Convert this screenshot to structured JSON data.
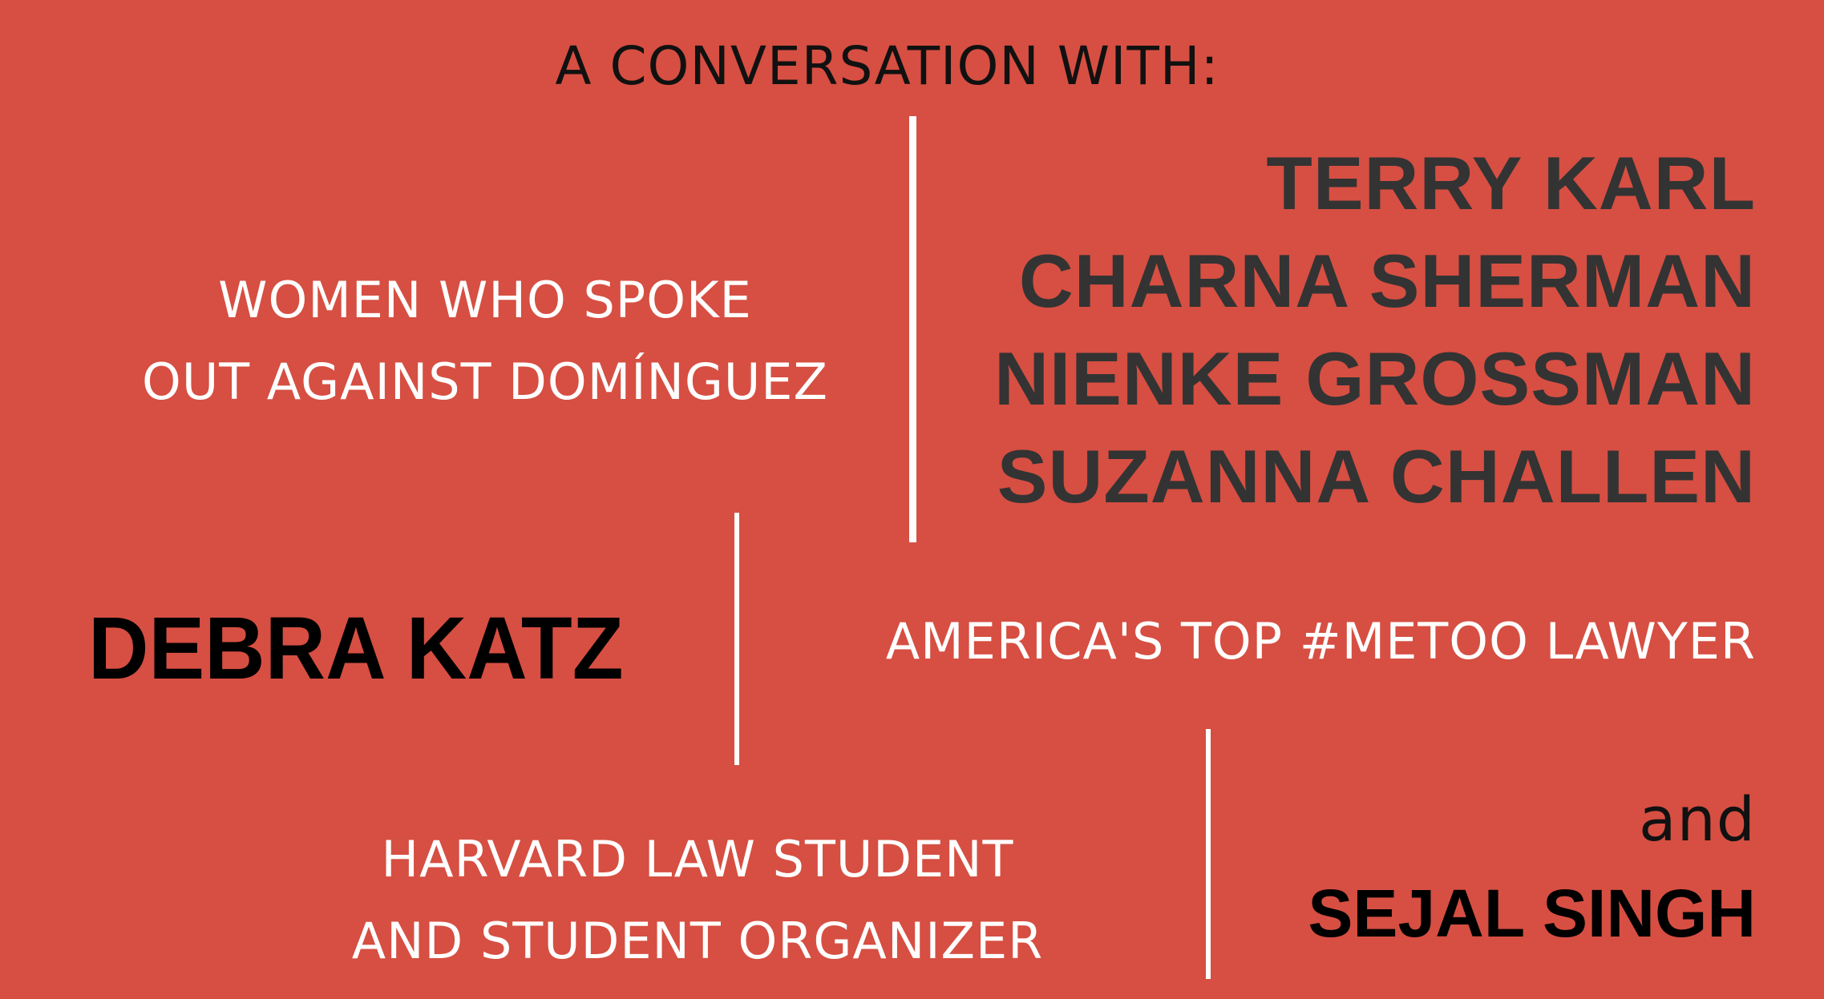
{
  "header": "A CONVERSATION WITH:",
  "section_1": {
    "description_lines": [
      "WOMEN WHO SPOKE",
      "OUT AGAINST DOMÍNGUEZ"
    ],
    "names": [
      "TERRY KARL",
      "CHARNA SHERMAN",
      "NIENKE GROSSMAN",
      "SUZANNA CHALLEN"
    ]
  },
  "section_2": {
    "name": "DEBRA KATZ",
    "description": "AMERICA'S TOP #METOO LAWYER"
  },
  "section_3": {
    "description_lines": [
      "HARVARD LAW STUDENT",
      "AND STUDENT ORGANIZER"
    ],
    "conjunction": "and",
    "name": "SEJAL SINGH"
  },
  "colors": {
    "background": "#d64f42",
    "divider": "#ffffff",
    "light_text": "#ffffff",
    "dark_text": "#333333",
    "black_text": "#000000"
  }
}
